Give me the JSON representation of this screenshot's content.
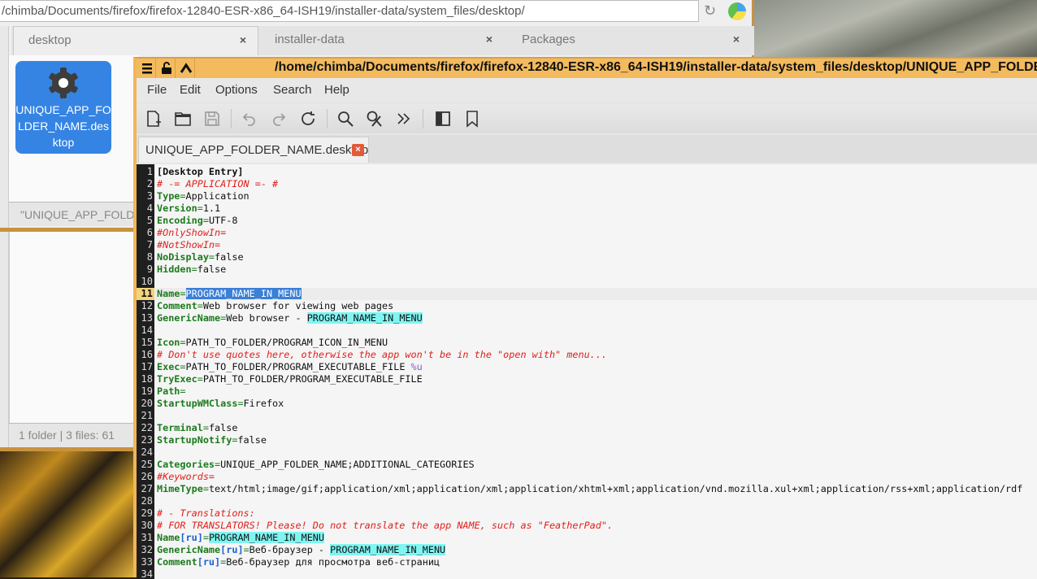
{
  "file_manager": {
    "address": "/chimba/Documents/firefox/firefox-12840-ESR-x86_64-ISH19/installer-data/system_files/desktop/",
    "tabs": [
      {
        "label": "desktop",
        "close": "×"
      },
      {
        "label": "installer-data",
        "close": "×"
      },
      {
        "label": "Packages",
        "close": "×"
      }
    ],
    "file": {
      "label": "UNIQUE_APP_FOLDER_NAME.desktop",
      "icon": "gear-icon"
    },
    "status_top": "\"UNIQUE_APP_FOLDE",
    "status_bottom": "1 folder  |  3 files: 61"
  },
  "editor": {
    "title": "/home/chimba/Documents/firefox/firefox-12840-ESR-x86_64-ISH19/installer-data/system_files/desktop/UNIQUE_APP_FOLDER_NAM",
    "menu": [
      "File",
      "Edit",
      "Options",
      "Search",
      "Help"
    ],
    "toolbar": [
      "new-file-icon",
      "open-folder-icon",
      "save-icon",
      "undo-icon",
      "redo-icon",
      "reload-icon",
      "find-icon",
      "replace-icon",
      "more-icon",
      "side-pane-icon",
      "bookmark-icon"
    ],
    "tab": {
      "label": "UNIQUE_APP_FOLDER_NAME.desktop",
      "close": "×"
    },
    "current_line": 11,
    "colors": {
      "title_bar": "#f3bb5e",
      "key": "#1c7a1c",
      "comment": "#e0201c",
      "selection": "#3b7fd6",
      "highlight": "#7ff5f2"
    },
    "lines": [
      [
        [
          "[Desktop Entry]",
          "sec"
        ]
      ],
      [
        [
          "# -= APPLICATION =- #",
          "cm"
        ]
      ],
      [
        [
          "Type",
          "key"
        ],
        [
          "=",
          "eq"
        ],
        [
          "Application",
          ""
        ]
      ],
      [
        [
          "Version",
          "key"
        ],
        [
          "=",
          "eq"
        ],
        [
          "1.1",
          ""
        ]
      ],
      [
        [
          "Encoding",
          "key"
        ],
        [
          "=",
          "eq"
        ],
        [
          "UTF-8",
          ""
        ]
      ],
      [
        [
          "#OnlyShowIn=",
          "cm"
        ]
      ],
      [
        [
          "#NotShowIn=",
          "cm"
        ]
      ],
      [
        [
          "NoDisplay",
          "key"
        ],
        [
          "=",
          "eq"
        ],
        [
          "false",
          ""
        ]
      ],
      [
        [
          "Hidden",
          "key"
        ],
        [
          "=",
          "eq"
        ],
        [
          "false",
          ""
        ]
      ],
      [],
      [
        [
          "Name",
          "key"
        ],
        [
          "=",
          "eq"
        ],
        [
          "PROGRAM_NAME_IN_MENU",
          "sel"
        ]
      ],
      [
        [
          "Comment",
          "key"
        ],
        [
          "=",
          "eq"
        ],
        [
          "Web browser for viewing web pages",
          ""
        ]
      ],
      [
        [
          "GenericName",
          "key"
        ],
        [
          "=",
          "eq"
        ],
        [
          "Web browser - ",
          ""
        ],
        [
          "PROGRAM_NAME_IN_MENU",
          "hl"
        ]
      ],
      [],
      [
        [
          "Icon",
          "key"
        ],
        [
          "=",
          "eq"
        ],
        [
          "PATH_TO_FOLDER/PROGRAM_ICON_IN_MENU",
          ""
        ]
      ],
      [
        [
          "# Don't use quotes here, otherwise the app won't be in the \"open with\" menu...",
          "cm"
        ]
      ],
      [
        [
          "Exec",
          "key"
        ],
        [
          "=",
          "eq"
        ],
        [
          "PATH_TO_FOLDER/PROGRAM_EXECUTABLE_FILE ",
          ""
        ],
        [
          "%u",
          "pct"
        ]
      ],
      [
        [
          "TryExec",
          "key"
        ],
        [
          "=",
          "eq"
        ],
        [
          "PATH_TO_FOLDER/PROGRAM_EXECUTABLE_FILE",
          ""
        ]
      ],
      [
        [
          "Path",
          "key"
        ],
        [
          "=",
          "eq"
        ]
      ],
      [
        [
          "StartupWMClass",
          "key"
        ],
        [
          "=",
          "eq"
        ],
        [
          "Firefox",
          ""
        ]
      ],
      [],
      [
        [
          "Terminal",
          "key"
        ],
        [
          "=",
          "eq"
        ],
        [
          "false",
          ""
        ]
      ],
      [
        [
          "StartupNotify",
          "key"
        ],
        [
          "=",
          "eq"
        ],
        [
          "false",
          ""
        ]
      ],
      [],
      [
        [
          "Categories",
          "key"
        ],
        [
          "=",
          "eq"
        ],
        [
          "UNIQUE_APP_FOLDER_NAME;ADDITIONAL_CATEGORIES",
          ""
        ]
      ],
      [
        [
          "#Keywords=",
          "cm"
        ]
      ],
      [
        [
          "MimeType",
          "key"
        ],
        [
          "=",
          "eq"
        ],
        [
          "text/html;image/gif;application/xml;application/xml;application/xhtml+xml;application/vnd.mozilla.xul+xml;application/rss+xml;application/rdf",
          ""
        ]
      ],
      [],
      [
        [
          "# - Translations:",
          "cm"
        ]
      ],
      [
        [
          "# FOR TRANSLATORS! Please! Do not translate the app NAME, such as \"FeatherPad\".",
          "cm"
        ]
      ],
      [
        [
          "Name",
          "key"
        ],
        [
          "[ru]",
          "br"
        ],
        [
          "=",
          "eq"
        ],
        [
          "PROGRAM_NAME_IN_MENU",
          "hl"
        ]
      ],
      [
        [
          "GenericName",
          "key"
        ],
        [
          "[ru]",
          "br"
        ],
        [
          "=",
          "eq"
        ],
        [
          "Веб-браузер - ",
          ""
        ],
        [
          "PROGRAM_NAME_IN_MENU",
          "hl"
        ]
      ],
      [
        [
          "Comment",
          "key"
        ],
        [
          "[ru]",
          "br"
        ],
        [
          "=",
          "eq"
        ],
        [
          "Веб-браузер для просмотра веб-страниц",
          ""
        ]
      ],
      []
    ]
  }
}
